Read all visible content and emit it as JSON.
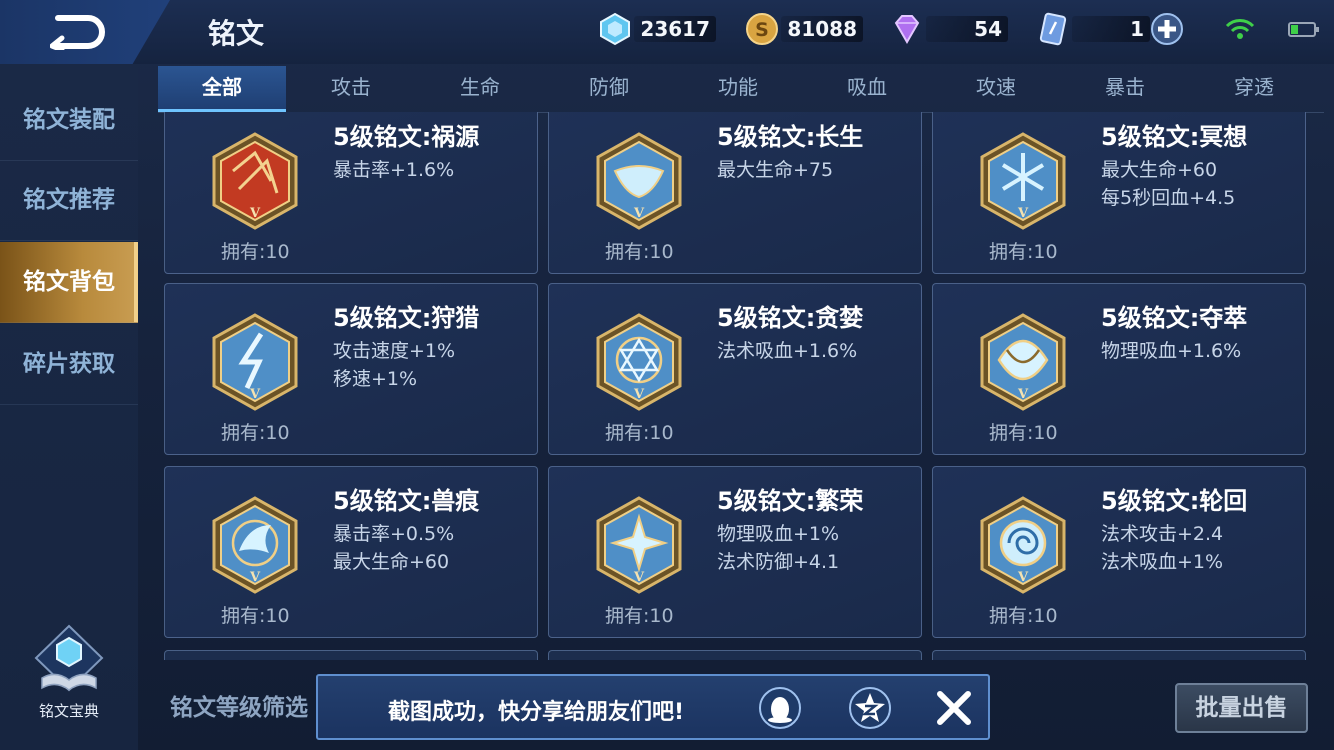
{
  "header": {
    "title": "铭文",
    "currencies": [
      {
        "name": "diamond-coupon",
        "value": "23617",
        "color": "#5fc6f0"
      },
      {
        "name": "gold-coin",
        "value": "81088",
        "color": "#d9a441"
      },
      {
        "name": "crystal",
        "value": "54",
        "color": "#b070f0"
      },
      {
        "name": "rune-card",
        "value": "1",
        "color": "#6e9be0"
      }
    ]
  },
  "sidebar": {
    "items": [
      {
        "label": "铭文装配"
      },
      {
        "label": "铭文推荐"
      },
      {
        "label": "铭文背包"
      },
      {
        "label": "碎片获取"
      }
    ],
    "active_index": 2,
    "codex_label": "铭文宝典"
  },
  "tabs": [
    "全部",
    "攻击",
    "生命",
    "防御",
    "功能",
    "吸血",
    "攻速",
    "暴击",
    "穿透"
  ],
  "active_tab": 0,
  "runes": [
    {
      "name": "5级铭文:祸源",
      "stat1": "暴击率+1.6%",
      "stat2": "",
      "owned": "拥有:10",
      "icon": "red-rune-icon",
      "color": "#c23a22"
    },
    {
      "name": "5级铭文:长生",
      "stat1": "最大生命+75",
      "stat2": "",
      "owned": "拥有:10",
      "icon": "blue-rune-icon",
      "color": "#4f8fc7"
    },
    {
      "name": "5级铭文:冥想",
      "stat1": "最大生命+60",
      "stat2": "每5秒回血+4.5",
      "owned": "拥有:10",
      "icon": "blue-rune-icon",
      "color": "#4f8fc7"
    },
    {
      "name": "5级铭文:狩猎",
      "stat1": "攻击速度+1%",
      "stat2": "移速+1%",
      "owned": "拥有:10",
      "icon": "blue-rune-icon",
      "color": "#4f8fc7"
    },
    {
      "name": "5级铭文:贪婪",
      "stat1": "法术吸血+1.6%",
      "stat2": "",
      "owned": "拥有:10",
      "icon": "blue-rune-icon",
      "color": "#4f8fc7"
    },
    {
      "name": "5级铭文:夺萃",
      "stat1": "物理吸血+1.6%",
      "stat2": "",
      "owned": "拥有:10",
      "icon": "blue-rune-icon",
      "color": "#4f8fc7"
    },
    {
      "name": "5级铭文:兽痕",
      "stat1": "暴击率+0.5%",
      "stat2": "最大生命+60",
      "owned": "拥有:10",
      "icon": "blue-rune-icon",
      "color": "#4f8fc7"
    },
    {
      "name": "5级铭文:繁荣",
      "stat1": "物理吸血+1%",
      "stat2": "法术防御+4.1",
      "owned": "拥有:10",
      "icon": "blue-rune-icon",
      "color": "#4f8fc7"
    },
    {
      "name": "5级铭文:轮回",
      "stat1": "法术攻击+2.4",
      "stat2": "法术吸血+1%",
      "owned": "拥有:10",
      "icon": "blue-rune-icon",
      "color": "#4f8fc7"
    }
  ],
  "bottom": {
    "filter_label": "铭文等级筛选",
    "toast_text": "截图成功，快分享给朋友们吧!",
    "sell_label": "批量出售"
  }
}
